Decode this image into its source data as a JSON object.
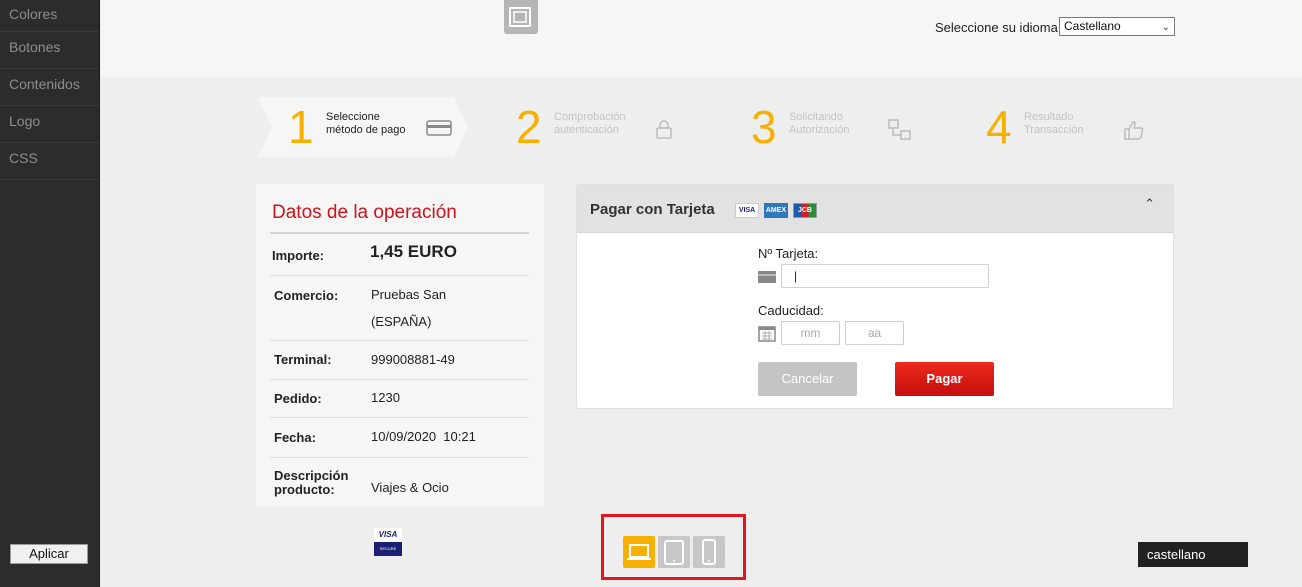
{
  "sidebar": {
    "items": [
      {
        "label": "Colores"
      },
      {
        "label": "Botones"
      },
      {
        "label": "Contenidos"
      },
      {
        "label": "Logo"
      },
      {
        "label": "CSS"
      }
    ],
    "apply_label": "Aplicar"
  },
  "header": {
    "logo_icon": "windows-icon",
    "language_label": "Seleccione su idioma",
    "language_selected": "Castellano"
  },
  "steps": [
    {
      "number": "1",
      "label_line1": "Seleccione",
      "label_line2": "método de pago",
      "icon": "card-icon",
      "active": true
    },
    {
      "number": "2",
      "label_line1": "Comprobación",
      "label_line2": "autenticación",
      "icon": "lock-icon",
      "active": false
    },
    {
      "number": "3",
      "label_line1": "Solicitando",
      "label_line2": "Autorización",
      "icon": "network-icon",
      "active": false
    },
    {
      "number": "4",
      "label_line1": "Resultado",
      "label_line2": "Transacción",
      "icon": "thumbs-up-icon",
      "active": false
    }
  ],
  "operation": {
    "title": "Datos de la operación",
    "rows": [
      {
        "key": "Importe:",
        "value": "1,45 EURO"
      },
      {
        "key": "Comercio:",
        "value": "Pruebas San",
        "value2": "(ESPAÑA)"
      },
      {
        "key": "Terminal:",
        "value": "999008881-49"
      },
      {
        "key": "Pedido:",
        "value": "1230"
      },
      {
        "key": "Fecha:",
        "value": "10/09/2020  10:21"
      },
      {
        "key": "Descripción",
        "key2": "producto:",
        "value": "Viajes & Ocio"
      }
    ]
  },
  "card": {
    "title": "Pagar con Tarjeta",
    "logos": [
      "VISA",
      "AMEX",
      "JCB"
    ],
    "card_number_label": "Nº Tarjeta:",
    "expiry_label": "Caducidad:",
    "month_placeholder": "mm",
    "year_placeholder": "aa",
    "cancel_label": "Cancelar",
    "pay_label": "Pagar"
  },
  "footer": {
    "visa_secure_top": "VISA",
    "visa_secure_bottom": "SECURE",
    "devices": [
      "laptop-icon",
      "tablet-icon",
      "phone-icon"
    ],
    "language_footer": "castellano"
  },
  "colors": {
    "accent_yellow": "#f5b000",
    "title_red": "#d0121b",
    "pay_red": "#d81a15",
    "highlight_border": "#e3151f"
  }
}
